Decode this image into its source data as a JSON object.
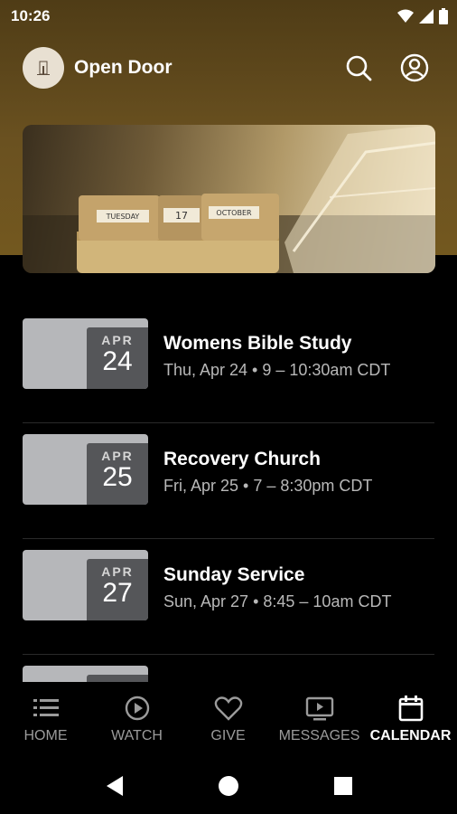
{
  "status_bar": {
    "time": "10:26"
  },
  "header": {
    "title": "Open Door"
  },
  "events": [
    {
      "month": "APR",
      "day": "24",
      "title": "Womens Bible Study",
      "meta": "Thu, Apr 24 • 9 – 10:30am CDT"
    },
    {
      "month": "APR",
      "day": "25",
      "title": "Recovery Church",
      "meta": "Fri, Apr 25 • 7 – 8:30pm CDT"
    },
    {
      "month": "APR",
      "day": "27",
      "title": "Sunday Service",
      "meta": "Sun, Apr 27 • 8:45 – 10am CDT"
    }
  ],
  "hero": {
    "calendar_day": "TUESDAY",
    "calendar_date": "17",
    "calendar_month": "OCTOBER"
  },
  "nav": {
    "items": [
      {
        "label": "HOME",
        "icon": "list-icon"
      },
      {
        "label": "WATCH",
        "icon": "play-circle-icon"
      },
      {
        "label": "GIVE",
        "icon": "heart-icon"
      },
      {
        "label": "MESSAGES",
        "icon": "tv-icon"
      },
      {
        "label": "CALENDAR",
        "icon": "calendar-icon"
      }
    ],
    "active": "CALENDAR"
  },
  "colors": {
    "header_bg": "#6a5120",
    "background": "#000000",
    "date_box": "#555659",
    "thumb": "#b6b7ba",
    "inactive_nav": "#9b9b9b"
  }
}
